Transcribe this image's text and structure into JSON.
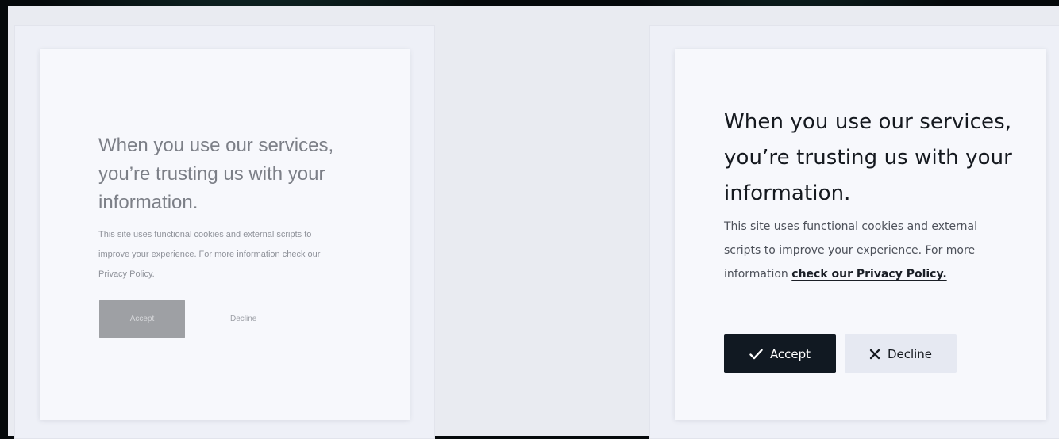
{
  "left_card": {
    "heading": "When you use our services, you’re trusting us with your information.",
    "body": "This site uses functional cookies and external scripts to improve your experience. For more information check our Privacy Policy.",
    "accept_label": "Accept",
    "decline_label": "Decline"
  },
  "right_card": {
    "heading": "When you use our services, you’re trusting us with your information.",
    "body_text": "This site uses functional cookies and external scripts to improve your experience. For more information",
    "privacy_link": "check our Privacy Policy.",
    "accept_label": "Accept",
    "accept_icon": "checkmark-icon",
    "decline_label": "Decline",
    "decline_icon": "x-close-icon"
  },
  "colors": {
    "backdrop": "#05090b",
    "stage": "#e9ebf1",
    "card": "#f7f8fc",
    "accept_dark": "#111922",
    "decline_light": "#e6e9f2",
    "faded_accept": "#9ea0a4"
  }
}
